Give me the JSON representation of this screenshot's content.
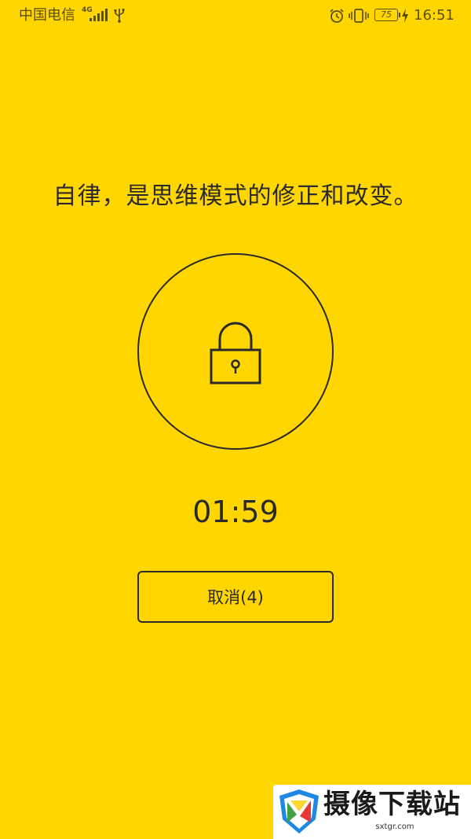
{
  "status_bar": {
    "carrier": "中国电信",
    "network_type": "4G",
    "battery_level": "75",
    "time": "16:51",
    "icons": [
      "signal-icon",
      "usb-icon",
      "alarm-icon",
      "vibrate-icon",
      "battery-icon",
      "charging-icon"
    ]
  },
  "main": {
    "quote": "自律，是思维模式的修正和改变。",
    "lock_icon": "lock-icon",
    "timer": "01:59",
    "cancel_label": "取消(4)"
  },
  "watermark": {
    "title": "摄像下载站",
    "subtitle": "sxtgr.com"
  },
  "colors": {
    "background": "#FFD600",
    "foreground": "#2a2a2a"
  }
}
